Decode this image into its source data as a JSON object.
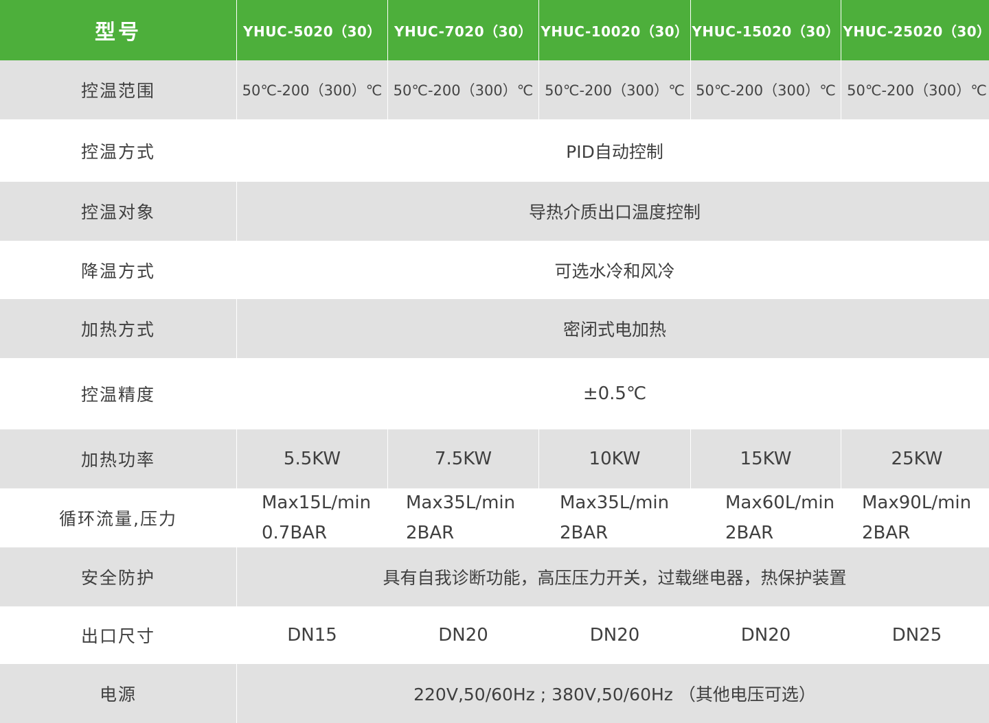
{
  "header": {
    "label": "型号",
    "models": [
      "YHUC-5020（30）",
      "YHUC-7020（30）",
      "YHUC-10020（30）",
      "YHUC-15020（30）",
      "YHUC-25020（30）"
    ]
  },
  "rows": {
    "temp_range": {
      "label": "控温范围",
      "values": [
        "50℃-200（300）℃",
        "50℃-200（300）℃",
        "50℃-200（300）℃",
        "50℃-200（300）℃",
        "50℃-200（300）℃"
      ]
    },
    "control_mode": {
      "label": "控温方式",
      "value": "PID自动控制"
    },
    "control_object": {
      "label": "控温对象",
      "value": "导热介质出口温度控制"
    },
    "cooling_mode": {
      "label": "降温方式",
      "value": "可选水冷和风冷"
    },
    "heating_mode": {
      "label": "加热方式",
      "value": "密闭式电加热"
    },
    "accuracy": {
      "label": "控温精度",
      "value": "±0.5℃"
    },
    "heating_power": {
      "label": "加热功率",
      "values": [
        "5.5KW",
        "7.5KW",
        "10KW",
        "15KW",
        "25KW"
      ]
    },
    "flow_pressure": {
      "label": "循环流量,压力",
      "values": [
        {
          "flow": "Max15L/min",
          "pressure": "0.7BAR"
        },
        {
          "flow": "Max35L/min",
          "pressure": "2BAR"
        },
        {
          "flow": "Max35L/min",
          "pressure": "2BAR"
        },
        {
          "flow": "Max60L/min",
          "pressure": "2BAR"
        },
        {
          "flow": "Max90L/min",
          "pressure": "2BAR"
        }
      ]
    },
    "safety": {
      "label": "安全防护",
      "value": "具有自我诊断功能，高压压力开关，过载继电器，热保护装置"
    },
    "outlet_size": {
      "label": "出口尺寸",
      "values": [
        "DN15",
        "DN20",
        "DN20",
        "DN20",
        "DN25"
      ]
    },
    "power_supply": {
      "label": "电源",
      "value": "220V,50/60Hz ; 380V,50/60Hz （其他电压可选）"
    }
  },
  "colors": {
    "header_green": "#4daf3b",
    "row_gray": "#e1e1e1",
    "text": "#3f3f3f"
  }
}
